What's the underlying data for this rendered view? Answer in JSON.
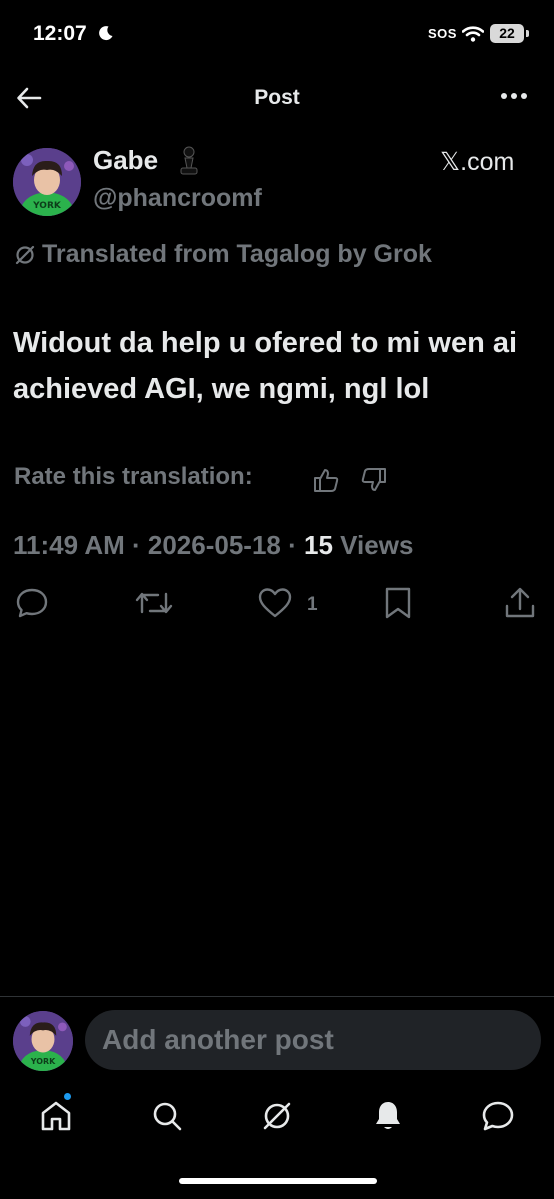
{
  "status_bar": {
    "time": "12:07",
    "sos": "SOS",
    "battery": "22"
  },
  "header": {
    "title": "Post",
    "back_icon": "arrow-left-icon",
    "more_icon": "more-horizontal-icon"
  },
  "post": {
    "author_name": "Gabe",
    "author_emoji": "♟",
    "handle": "@phancroomf",
    "source": "𝕏.com",
    "translated_note": "Translated from Tagalog by Grok",
    "text": "Widout da help u ofered to mi wen ai achieved AGI, we ngmi, ngl lol",
    "rate_label": "Rate this translation:",
    "time": "11:49 AM",
    "date": "2026-05-18",
    "views_count": "15",
    "views_label": "Views",
    "like_count": "1"
  },
  "compose": {
    "placeholder": "Add another post"
  },
  "bottom_nav": [
    "home-icon",
    "search-icon",
    "grok-icon",
    "notifications-icon",
    "messages-icon"
  ],
  "colors": {
    "background": "#000000",
    "text_primary": "#e7e9ea",
    "text_secondary": "#71767b",
    "accent": "#1d9bf0"
  }
}
